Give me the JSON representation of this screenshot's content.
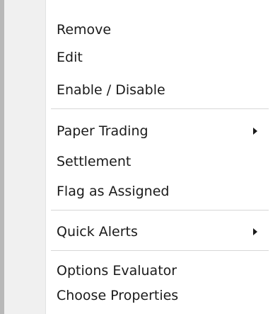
{
  "menu": {
    "items": [
      {
        "label": "Remove",
        "submenu": false
      },
      {
        "label": "Edit",
        "submenu": false
      },
      {
        "label": "Enable / Disable",
        "submenu": false
      },
      {
        "label": "Paper Trading",
        "submenu": true
      },
      {
        "label": "Settlement",
        "submenu": false
      },
      {
        "label": "Flag as Assigned",
        "submenu": false
      },
      {
        "label": "Quick Alerts",
        "submenu": true
      },
      {
        "label": "Options Evaluator",
        "submenu": false
      },
      {
        "label": "Choose Properties",
        "submenu": false
      }
    ]
  },
  "icons": {
    "submenu_arrow": "chevron-right-icon"
  },
  "colors": {
    "text": "#1a1a1a",
    "gutter": "#f0f0f0",
    "separator": "#d7d7d7",
    "border": "#b8b8b8",
    "background": "#ffffff"
  }
}
